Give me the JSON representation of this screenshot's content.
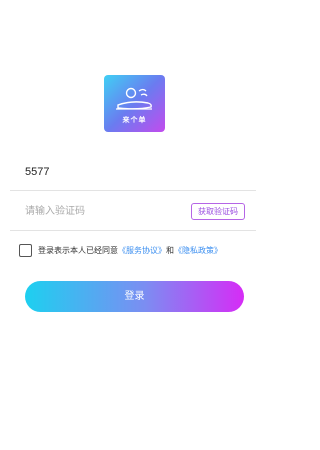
{
  "logo": {
    "text": "来个单",
    "accent_from": "#3fd0f4",
    "accent_to": "#c34bee"
  },
  "form": {
    "phone_value": "5577",
    "code_placeholder": "请输入验证码",
    "get_code_label": "获取验证码"
  },
  "agreement": {
    "prefix": "登录表示本人已经同意",
    "service_link": "《服务协议》",
    "conjunction": "和",
    "privacy_link": "《隐私政策》",
    "link_color": "#3a8ef0"
  },
  "login": {
    "label": "登录"
  }
}
